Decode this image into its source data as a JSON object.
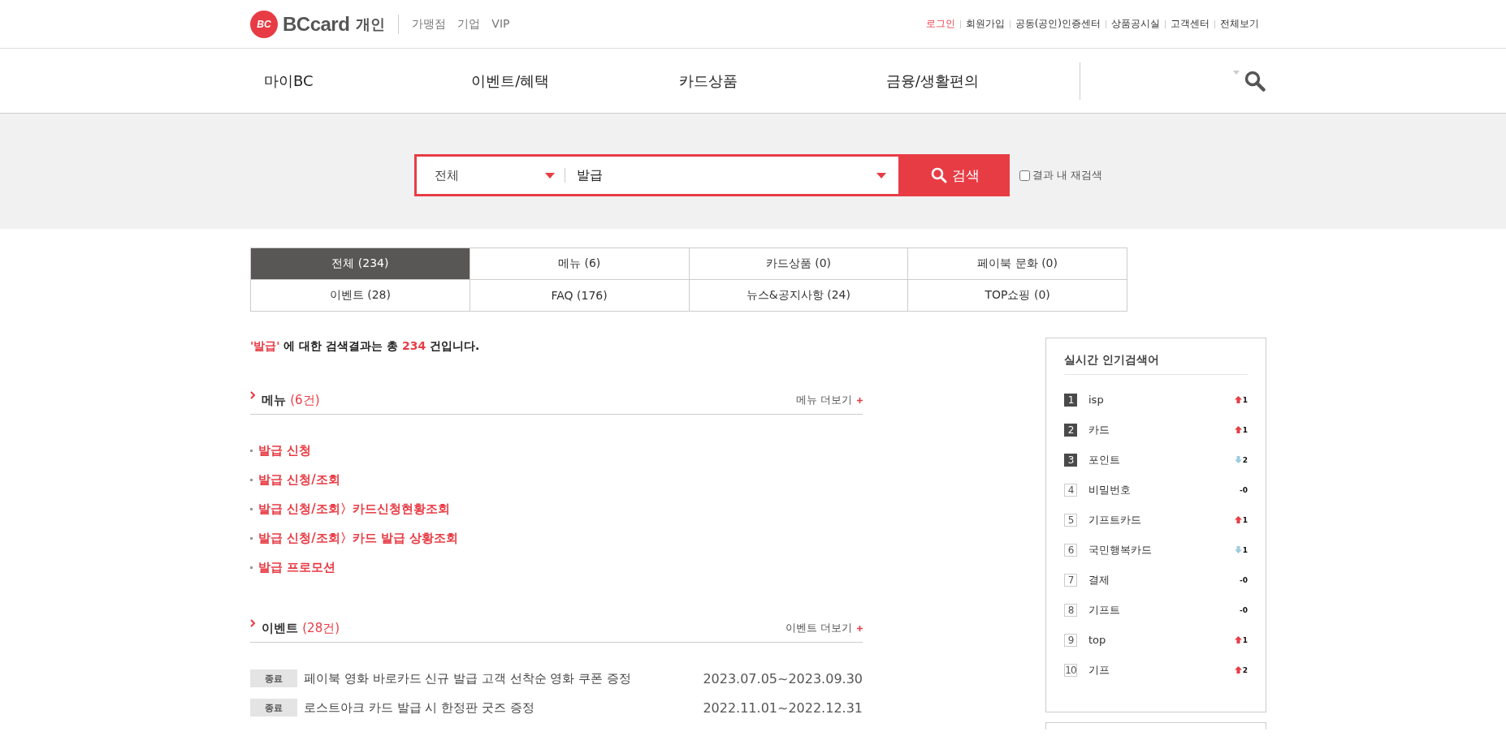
{
  "header": {
    "logo_mark": "BC",
    "logo_text": "BCcard",
    "site": "개인",
    "site_links": [
      "가맹점",
      "기업",
      "VIP"
    ],
    "util_links": [
      {
        "label": "로그인",
        "highlighted": true
      },
      {
        "label": "회원가입",
        "highlighted": false
      },
      {
        "label": "공동(공인)인증센터",
        "highlighted": false
      },
      {
        "label": "상품공시실",
        "highlighted": false
      },
      {
        "label": "고객센터",
        "highlighted": false
      },
      {
        "label": "전체보기",
        "highlighted": false
      }
    ]
  },
  "nav": [
    "마이BC",
    "이벤트/혜택",
    "카드상품",
    "금융/생활편의"
  ],
  "search": {
    "category": "전체",
    "query": "발급",
    "button": "검색",
    "research": {
      "label": "결과 내 재검색",
      "checked": false
    }
  },
  "tabs": [
    {
      "label": "전체 (234)",
      "selected": true
    },
    {
      "label": "메뉴 (6)",
      "selected": false
    },
    {
      "label": "카드상품 (0)",
      "selected": false
    },
    {
      "label": "페이북 문화 (0)",
      "selected": false
    },
    {
      "label": "이벤트 (28)",
      "selected": false
    },
    {
      "label": "FAQ (176)",
      "selected": false
    },
    {
      "label": "뉴스&공지사항 (24)",
      "selected": false
    },
    {
      "label": "TOP쇼핑 (0)",
      "selected": false
    }
  ],
  "summary_parts": {
    "keyword": "'발급'",
    "before": " 에 대한 검색결과는 총 ",
    "count": "234",
    "after": " 건입니다."
  },
  "sections": [
    {
      "kind": "menu",
      "title": "메뉴",
      "count": "(6건)",
      "more": "메뉴 더보기",
      "items": [
        "발급 신청",
        "발급 신청/조회",
        "발급 신청/조회〉카드신청현황조회",
        "발급 신청/조회〉카드 발급 상황조회",
        "발급 프로모션"
      ]
    },
    {
      "kind": "event",
      "title": "이벤트",
      "count": "(28건)",
      "more": "이벤트 더보기",
      "items": [
        {
          "status": "종료",
          "title": "페이북 영화 바로카드 신규 발급 고객 선착순 영화 쿠폰 증정",
          "period": "2023.07.05~2023.09.30"
        },
        {
          "status": "종료",
          "title": "로스트아크 카드 발급 시 한정판 굿즈 증정",
          "period": "2022.11.01~2022.12.31"
        }
      ]
    }
  ],
  "popular": {
    "title": "실시간 인기검색어",
    "items": [
      {
        "rank": "1",
        "term": "isp",
        "highlighted": true,
        "kind": "up",
        "change": "1"
      },
      {
        "rank": "2",
        "term": "카드",
        "highlighted": true,
        "kind": "up",
        "change": "1"
      },
      {
        "rank": "3",
        "term": "포인트",
        "highlighted": true,
        "kind": "down",
        "change": "2"
      },
      {
        "rank": "4",
        "term": "비밀번호",
        "highlighted": false,
        "kind": "flat",
        "change": "-0"
      },
      {
        "rank": "5",
        "term": "기프트카드",
        "highlighted": false,
        "kind": "up",
        "change": "1"
      },
      {
        "rank": "6",
        "term": "국민행복카드",
        "highlighted": false,
        "kind": "down",
        "change": "1"
      },
      {
        "rank": "7",
        "term": "결제",
        "highlighted": false,
        "kind": "flat",
        "change": "-0"
      },
      {
        "rank": "8",
        "term": "기프트",
        "highlighted": false,
        "kind": "flat",
        "change": "-0"
      },
      {
        "rank": "9",
        "term": "top",
        "highlighted": false,
        "kind": "up",
        "change": "1"
      },
      {
        "rank": "10",
        "term": "기프",
        "highlighted": false,
        "kind": "up",
        "change": "2"
      }
    ]
  }
}
